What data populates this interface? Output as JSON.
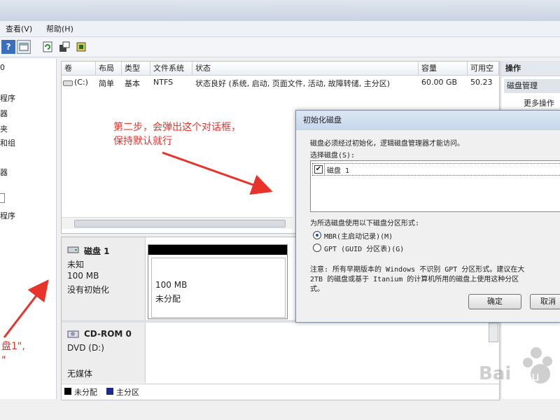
{
  "menu": {
    "view": "查看(V)",
    "help": "帮助(H)"
  },
  "left_tree": [
    "0",
    "程序",
    "器",
    "夹",
    "和组",
    "器",
    "",
    "程序"
  ],
  "volume_table": {
    "columns": [
      "卷",
      "布局",
      "类型",
      "文件系统",
      "状态",
      "容量",
      "可用空"
    ],
    "row": {
      "volume": "(C:)",
      "layout": "简单",
      "type": "基本",
      "fs": "NTFS",
      "status": "状态良好 (系统, 启动, 页面文件, 活动, 故障转储, 主分区)",
      "capacity": "60.00 GB",
      "free": "50.23"
    }
  },
  "disks": {
    "disk1": {
      "name": "磁盘 1",
      "type": "未知",
      "size": "100 MB",
      "state": "没有初始化",
      "part_size": "100 MB",
      "part_state": "未分配"
    },
    "cdrom": {
      "name": "CD-ROM 0",
      "drive": "DVD (D:)",
      "state": "无媒体"
    }
  },
  "legend": {
    "unallocated": "未分配",
    "primary": "主分区"
  },
  "actions": {
    "header": "操作",
    "disk_mgmt": "磁盘管理",
    "more": "更多操作"
  },
  "dialog": {
    "title": "初始化磁盘",
    "desc": "磁盘必须经过初始化，逻辑磁盘管理器才能访问。",
    "select_label": "选择磁盘(S):",
    "disk_item": "磁盘 1",
    "style_label": "为所选磁盘使用以下磁盘分区形式:",
    "mbr": "MBR(主启动记录)(M)",
    "gpt": "GPT (GUID 分区表)(G)",
    "note1": "注意: 所有早期版本的 Windows 不识别 GPT 分区形式。建议在大",
    "note2": "2TB 的磁盘或基于 Itanium 的计算机所用的磁盘上使用这种分区",
    "note3": "式。",
    "ok": "确定",
    "cancel": "取消"
  },
  "annotations": {
    "step2_line1": "第二步，会弹出这个对话框，",
    "step2_line2": "保持默认就行",
    "left_line1": "盘1\",",
    "left_line2": "\""
  },
  "colors": {
    "annotation": "#e8332b",
    "unallocated": "#000000",
    "primary": "#1a2b8c"
  }
}
